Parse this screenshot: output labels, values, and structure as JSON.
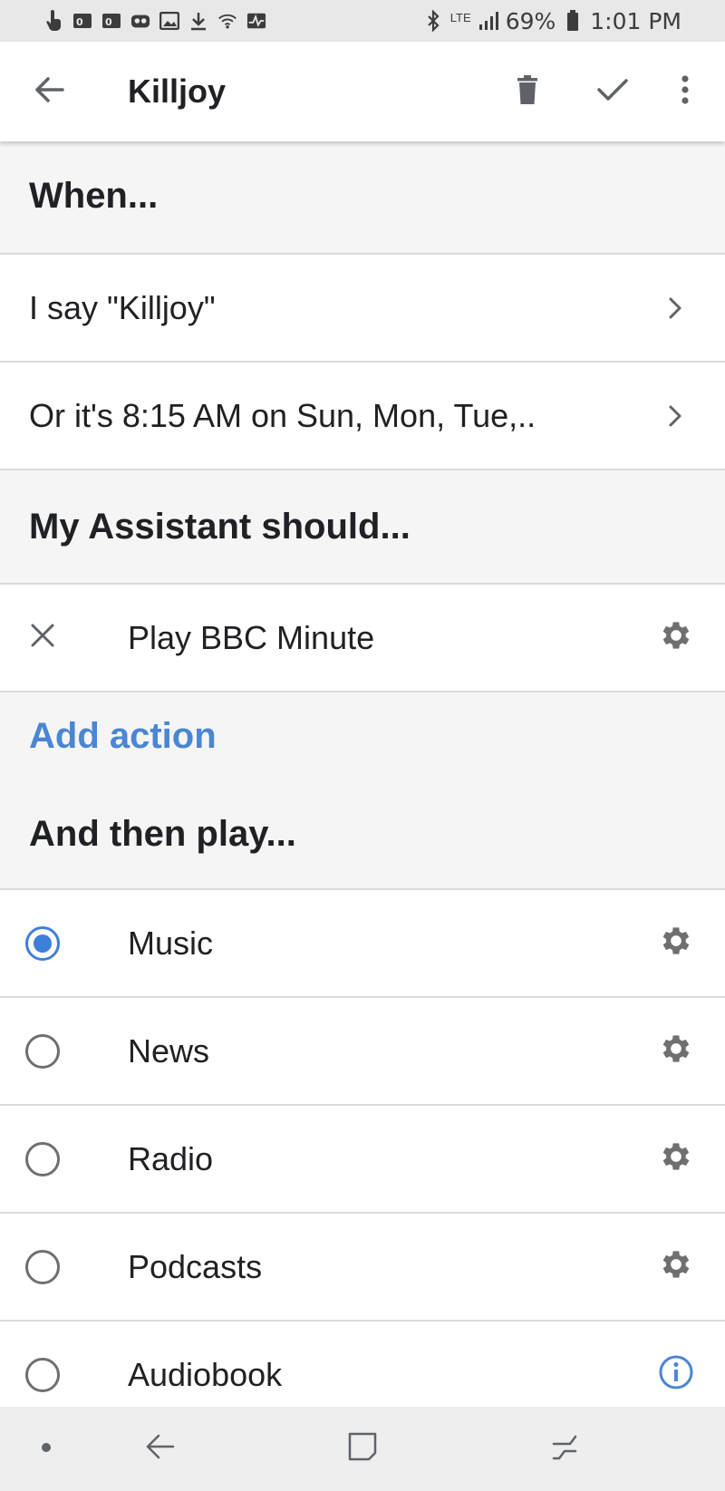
{
  "status_bar": {
    "icons_left": [
      "touch-icon",
      "outlook-icon",
      "outlook-icon",
      "voicemail-icon",
      "image-icon",
      "download-icon",
      "wifi-calling-icon",
      "pulse-icon"
    ],
    "icons_right": [
      "bluetooth-icon",
      "lte-icon",
      "signal-icon",
      "battery-icon"
    ],
    "network_label": "LTE",
    "battery": "69%",
    "time": "1:01 PM"
  },
  "app_bar": {
    "title": "Killjoy",
    "icons": [
      "back-arrow-icon",
      "trash-icon",
      "check-icon",
      "more-vert-icon"
    ]
  },
  "when_section": {
    "header": "When...",
    "rows": [
      {
        "text": "I say \"Killjoy\""
      },
      {
        "text": "Or it's 8:15 AM on Sun, Mon, Tue,.."
      }
    ]
  },
  "assistant_section": {
    "header": "My Assistant should...",
    "actions": [
      {
        "text": "Play BBC Minute"
      }
    ],
    "add_action": "Add action"
  },
  "play_section": {
    "header": "And then play...",
    "options": [
      {
        "label": "Music",
        "selected": true,
        "trailing_icon": "gear-icon"
      },
      {
        "label": "News",
        "selected": false,
        "trailing_icon": "gear-icon"
      },
      {
        "label": "Radio",
        "selected": false,
        "trailing_icon": "gear-icon"
      },
      {
        "label": "Podcasts",
        "selected": false,
        "trailing_icon": "gear-icon"
      },
      {
        "label": "Audiobook",
        "selected": false,
        "trailing_icon": "info-icon"
      }
    ]
  },
  "nav_bar": {
    "icons": [
      "dot-icon",
      "back-icon",
      "home-icon",
      "recents-icon"
    ]
  },
  "colors": {
    "accent": "#4a86d4",
    "radio_selected": "#3d7fdb",
    "header_bg": "#f5f5f5",
    "divider": "#dadada",
    "icon_gray": "#6f6f6f"
  }
}
